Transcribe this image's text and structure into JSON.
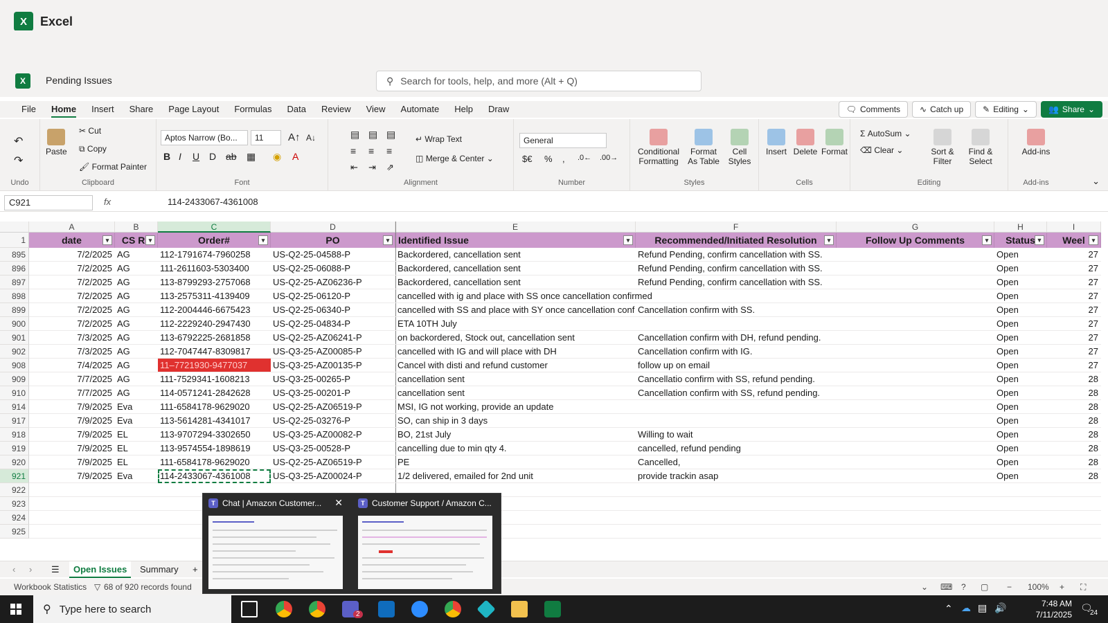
{
  "app": {
    "name": "Excel",
    "logo_letter": "X"
  },
  "document": {
    "title": "Pending Issues"
  },
  "search": {
    "placeholder": "Search for tools, help, and more (Alt + Q)"
  },
  "ribbon_tabs": [
    "File",
    "Home",
    "Insert",
    "Share",
    "Page Layout",
    "Formulas",
    "Data",
    "Review",
    "View",
    "Automate",
    "Help",
    "Draw"
  ],
  "top_actions": {
    "comments": "Comments",
    "catch_up": "Catch up",
    "editing": "Editing",
    "share": "Share"
  },
  "ribbon": {
    "undo": "Undo",
    "paste": "Paste",
    "cut": "Cut",
    "copy": "Copy",
    "format_painter": "Format Painter",
    "clipboard": "Clipboard",
    "font_name": "Aptos Narrow (Bo...",
    "font_size": "11",
    "font": "Font",
    "wrap_text": "Wrap Text",
    "merge_center": "Merge & Center",
    "alignment": "Alignment",
    "number_format": "General",
    "number": "Number",
    "conditional_formatting": "Conditional Formatting",
    "format_as_table": "Format As Table",
    "cell_styles": "Cell Styles",
    "styles": "Styles",
    "insert": "Insert",
    "delete": "Delete",
    "format": "Format",
    "cells": "Cells",
    "autosum": "AutoSum",
    "clear": "Clear",
    "sort_filter": "Sort & Filter",
    "find_select": "Find & Select",
    "editing": "Editing",
    "addins": "Add-ins",
    "addins_group": "Add-ins"
  },
  "formula_bar": {
    "name_box": "C921",
    "fx": "fx",
    "content": "114-2433067-4361008"
  },
  "columns": [
    "A",
    "B",
    "C",
    "D",
    "E",
    "F",
    "G",
    "H",
    "I"
  ],
  "header_row": {
    "row_num": "1",
    "cells": [
      "date",
      "CS Re",
      "Order#",
      "PO",
      "Identified Issue",
      "Recommended/Initiated Resolution",
      "Follow Up Comments",
      "Status",
      "Weel"
    ]
  },
  "rows": [
    {
      "n": "895",
      "date": "7/2/2025",
      "cs": "AG",
      "order": "112-1791674-7960258",
      "po": "US-Q2-25-04588-P",
      "issue": "Backordered, cancellation sent",
      "res": "Refund Pending, confirm cancellation with SS.",
      "follow": "",
      "status": "Open",
      "week": "27"
    },
    {
      "n": "896",
      "date": "7/2/2025",
      "cs": "AG",
      "order": "111-2611603-5303400",
      "po": "US-Q2-25-06088-P",
      "issue": "Backordered, cancellation sent",
      "res": "Refund Pending, confirm cancellation with SS.",
      "follow": "",
      "status": "Open",
      "week": "27"
    },
    {
      "n": "897",
      "date": "7/2/2025",
      "cs": "AG",
      "order": "113-8799293-2757068",
      "po": "US-Q2-25-AZ06236-P",
      "issue": "Backordered, cancellation sent",
      "res": "Refund Pending, confirm cancellation with SS.",
      "follow": "",
      "status": "Open",
      "week": "27"
    },
    {
      "n": "898",
      "date": "7/2/2025",
      "cs": "AG",
      "order": "113-2575311-4139409",
      "po": "US-Q2-25-06120-P",
      "issue": "cancelled with ig and place with SS once cancellation confirmed",
      "res": "",
      "follow": "",
      "status": "Open",
      "week": "27"
    },
    {
      "n": "899",
      "date": "7/2/2025",
      "cs": "AG",
      "order": "112-2004446-6675423",
      "po": "US-Q2-25-06340-P",
      "issue": "cancelled with SS and place with SY once cancellation conf",
      "res": "Cancellation confirm with SS.",
      "follow": "",
      "status": "Open",
      "week": "27"
    },
    {
      "n": "900",
      "date": "7/2/2025",
      "cs": "AG",
      "order": "112-2229240-2947430",
      "po": "US-Q2-25-04834-P",
      "issue": "ETA 10TH July",
      "res": "",
      "follow": "",
      "status": "Open",
      "week": "27"
    },
    {
      "n": "901",
      "date": "7/3/2025",
      "cs": "AG",
      "order": "113-6792225-2681858",
      "po": "US-Q2-25-AZ06241-P",
      "issue": "on backordered, Stock out, cancellation sent",
      "res": "Cancellation confirm with DH, refund pending.",
      "follow": "",
      "status": "Open",
      "week": "27"
    },
    {
      "n": "902",
      "date": "7/3/2025",
      "cs": "AG",
      "order": "112-7047447-8309817",
      "po": "US-Q3-25-AZ00085-P",
      "issue": "cancelled with IG and will place with DH",
      "res": "Cancellation confirm with IG.",
      "follow": "",
      "status": "Open",
      "week": "27"
    },
    {
      "n": "908",
      "date": "7/4/2025",
      "cs": "AG",
      "order": "11–7721930-9477037",
      "po": "US-Q3-25-AZ00135-P",
      "issue": "Cancel with disti and refund customer",
      "res": "follow up on email",
      "follow": "",
      "status": "Open",
      "week": "27",
      "red": true
    },
    {
      "n": "909",
      "date": "7/7/2025",
      "cs": "AG",
      "order": "111-7529341-1608213",
      "po": "US-Q3-25-00265-P",
      "issue": "cancellation sent",
      "res": "Cancellatio confirm with SS, refund pending.",
      "follow": "",
      "status": "Open",
      "week": "28"
    },
    {
      "n": "910",
      "date": "7/7/2025",
      "cs": "AG",
      "order": "114-0571241-2842628",
      "po": "US-Q3-25-00201-P",
      "issue": "cancellation sent",
      "res": "Cancellation confirm with SS, refund pending.",
      "follow": "",
      "status": "Open",
      "week": "28"
    },
    {
      "n": "914",
      "date": "7/9/2025",
      "cs": "Eva",
      "order": "111-6584178-9629020",
      "po": "US-Q2-25-AZ06519-P",
      "issue": "MSI, IG not working, provide an update",
      "res": "",
      "follow": "",
      "status": "Open",
      "week": "28"
    },
    {
      "n": "917",
      "date": "7/9/2025",
      "cs": "Eva",
      "order": "113-5614281-4341017",
      "po": "US-Q2-25-03276-P",
      "issue": "SO, can ship in 3 days",
      "res": "",
      "follow": "",
      "status": "Open",
      "week": "28"
    },
    {
      "n": "918",
      "date": "7/9/2025",
      "cs": "EL",
      "order": "113-9707294-3302650",
      "po": "US-Q3-25-AZ00082-P",
      "issue": "BO, 21st July",
      "res": "Willing to wait",
      "follow": "",
      "status": "Open",
      "week": "28"
    },
    {
      "n": "919",
      "date": "7/9/2025",
      "cs": "EL",
      "order": "113-9574554-1898619",
      "po": "US-Q3-25-00528-P",
      "issue": "cancelling due to min qty 4.",
      "res": "cancelled, refund pending",
      "follow": "",
      "status": "Open",
      "week": "28"
    },
    {
      "n": "920",
      "date": "7/9/2025",
      "cs": "EL",
      "order": "111-6584178-9629020",
      "po": "US-Q2-25-AZ06519-P",
      "issue": "PE",
      "res": "Cancelled,",
      "follow": "",
      "status": "Open",
      "week": "28"
    },
    {
      "n": "921",
      "date": "7/9/2025",
      "cs": "Eva",
      "order": "114-2433067-4361008",
      "po": "US-Q3-25-AZ00024-P",
      "issue": "1/2 delivered, emailed for 2nd unit",
      "res": "provide trackin asap",
      "follow": "",
      "status": "Open",
      "week": "28",
      "active": true
    },
    {
      "n": "922",
      "date": "",
      "cs": "",
      "order": "",
      "po": "",
      "issue": "",
      "res": "",
      "follow": "",
      "status": "",
      "week": ""
    },
    {
      "n": "923",
      "date": "",
      "cs": "",
      "order": "",
      "po": "",
      "issue": "",
      "res": "",
      "follow": "",
      "status": "",
      "week": ""
    },
    {
      "n": "924",
      "date": "",
      "cs": "",
      "order": "",
      "po": "",
      "issue": "",
      "res": "",
      "follow": "",
      "status": "",
      "week": ""
    },
    {
      "n": "925",
      "date": "",
      "cs": "",
      "order": "",
      "po": "",
      "issue": "",
      "res": "",
      "follow": "",
      "status": "",
      "week": ""
    }
  ],
  "sheets": {
    "active": "Open Issues",
    "other": "Summary",
    "add": "+"
  },
  "status": {
    "workbook_stats": "Workbook Statistics",
    "records": "68 of 920 records found",
    "zoom": "100%"
  },
  "taskbar": {
    "search_placeholder": "Type here to search",
    "time": "7:48 AM",
    "date": "7/11/2025",
    "notification_count": "24",
    "teams_badge": "2"
  },
  "teams_popup": [
    {
      "title": "Chat | Amazon Customer...",
      "close": "✕"
    },
    {
      "title": "Customer Support / Amazon C..."
    }
  ],
  "colors": {
    "header_fill": "#cc99cc",
    "red_fill": "#e0312f",
    "accent": "#107c41"
  }
}
